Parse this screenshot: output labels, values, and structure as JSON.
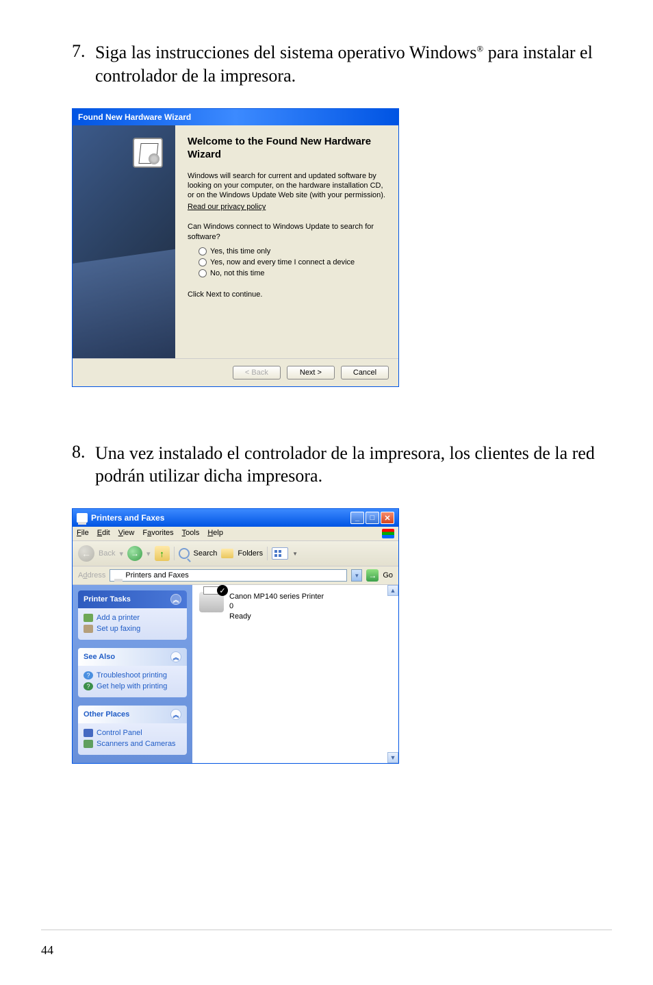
{
  "step7": {
    "num": "7.",
    "text_a": "Siga las instrucciones del sistema operativo Windows",
    "text_b": " para instalar el controlador de la impresora.",
    "reg": "®"
  },
  "dialog1": {
    "titlebar": "Found New Hardware Wizard",
    "heading": "Welcome to the Found New Hardware Wizard",
    "para1": "Windows will search for current and updated software by looking on your computer, on the hardware installation CD, or on the Windows Update Web site (with your permission).",
    "privacy_link": "Read our privacy policy",
    "question": "Can Windows connect to Windows Update to search for software?",
    "radio1": "Yes, this time only",
    "radio2": "Yes, now and every time I connect a device",
    "radio3": "No, not this time",
    "continue": "Click Next to continue.",
    "btn_back": "< Back",
    "btn_next": "Next >",
    "btn_cancel": "Cancel"
  },
  "step8": {
    "num": "8.",
    "text": "Una vez instalado el controlador de la impresora, los clientes de la red podrán utilizar dicha impresora."
  },
  "window2": {
    "title": "Printers and Faxes",
    "menu": {
      "file": "File",
      "edit": "Edit",
      "view": "View",
      "favorites": "Favorites",
      "tools": "Tools",
      "help": "Help"
    },
    "toolbar": {
      "back": "Back",
      "search": "Search",
      "folders": "Folders"
    },
    "address": {
      "label": "Address",
      "value": "Printers and Faxes",
      "go": "Go"
    },
    "tasks": {
      "printer_tasks": "Printer Tasks",
      "add_printer": "Add a printer",
      "setup_faxing": "Set up faxing",
      "see_also": "See Also",
      "troubleshoot": "Troubleshoot printing",
      "get_help": "Get help with printing",
      "other_places": "Other Places",
      "control_panel": "Control Panel",
      "scanners": "Scanners and Cameras"
    },
    "printer": {
      "name": "Canon MP140 series Printer",
      "docs": "0",
      "status": "Ready"
    }
  },
  "page_num": "44"
}
